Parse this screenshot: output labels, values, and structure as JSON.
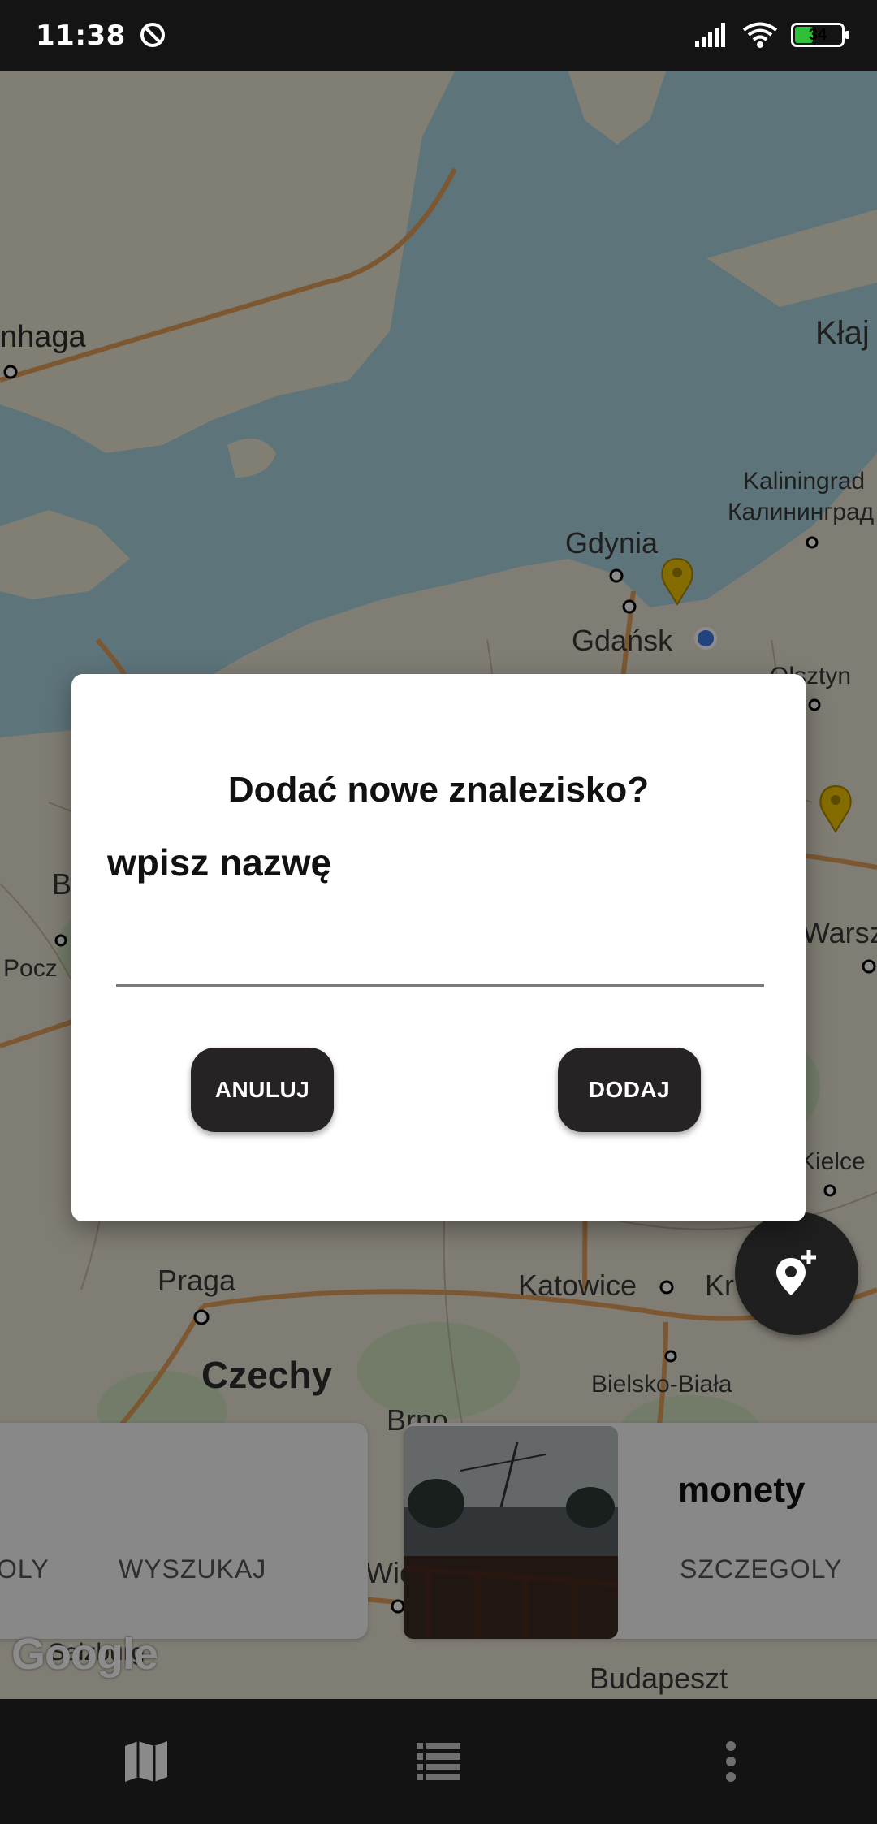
{
  "status_bar": {
    "time": "11:38",
    "battery": "34",
    "icons": [
      "do-not-disturb-icon",
      "signal-icon",
      "wifi-icon",
      "battery-icon"
    ]
  },
  "map": {
    "labels": [
      {
        "text": "nhaga",
        "cls": "big-plain"
      },
      {
        "text": "Kłaj"
      },
      {
        "text": "Kaliningrad"
      },
      {
        "text": "Калининград"
      },
      {
        "text": "Gdynia"
      },
      {
        "text": "Gdańsk"
      },
      {
        "text": "Olsztyn"
      },
      {
        "text": "Warsz"
      },
      {
        "text": "Pocz"
      },
      {
        "text": "B"
      },
      {
        "text": "Kielce"
      },
      {
        "text": "Praga"
      },
      {
        "text": "Katowice"
      },
      {
        "text": "Kr"
      },
      {
        "text": "Czechy"
      },
      {
        "text": "Bielsko-Biała"
      },
      {
        "text": "Brno"
      },
      {
        "text": "Wie"
      },
      {
        "text": "Budapeszt"
      },
      {
        "text": "Salzburg"
      }
    ],
    "google_logo": "Google"
  },
  "cards": {
    "left": {
      "action_left": "OLY",
      "action_right": "WYSZUKAJ"
    },
    "right": {
      "title": "monety",
      "action": "SZCZEGOLY"
    }
  },
  "dialog": {
    "title": "Dodać nowe znalezisko?",
    "prompt": "wpisz nazwę",
    "input_value": "",
    "cancel_label": "ANULUJ",
    "add_label": "DODAJ"
  },
  "fab": {
    "icon": "add-location-icon"
  },
  "bottom_nav": {
    "items": [
      "map-icon",
      "list-icon",
      "more-vert-icon"
    ]
  }
}
